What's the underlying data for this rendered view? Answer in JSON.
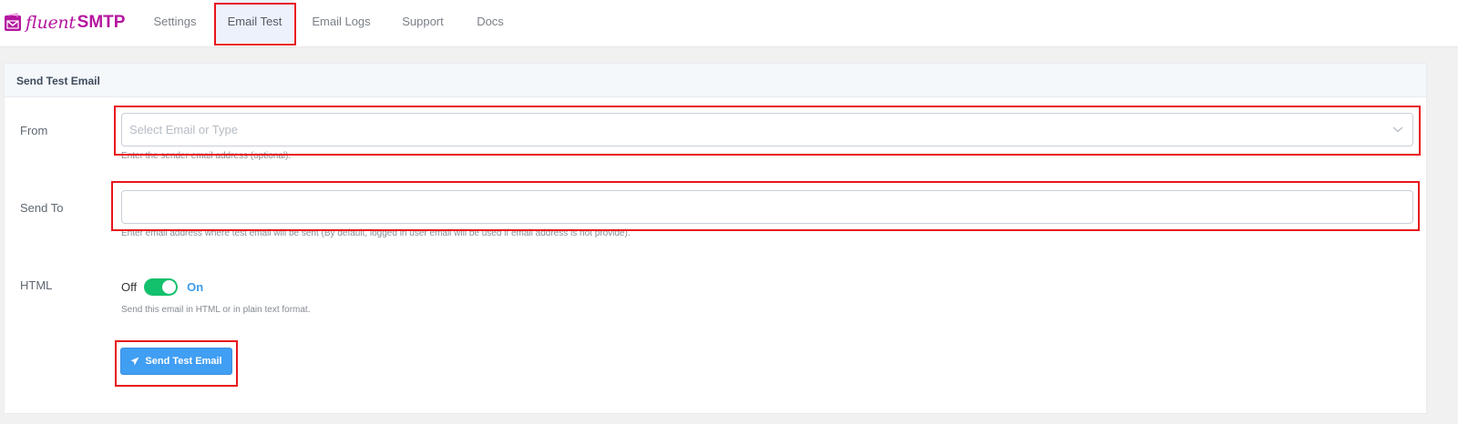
{
  "brand": {
    "name_prefix": "fluent",
    "name_suffix": "SMTP",
    "color": "#b5159f",
    "icon": "envelope-logo-icon"
  },
  "nav": {
    "tabs": [
      {
        "label": "Settings",
        "active": false
      },
      {
        "label": "Email Test",
        "active": true
      },
      {
        "label": "Email Logs",
        "active": false
      },
      {
        "label": "Support",
        "active": false
      },
      {
        "label": "Docs",
        "active": false
      }
    ]
  },
  "panel": {
    "title": "Send Test Email"
  },
  "form": {
    "from": {
      "label": "From",
      "placeholder": "Select Email or Type",
      "value": "",
      "help": "Enter the sender email address (optional)."
    },
    "send_to": {
      "label": "Send To",
      "placeholder": "",
      "value": "",
      "help": "Enter email address where test email will be sent (By default, logged in user email will be used if email address is not provide)."
    },
    "html": {
      "label": "HTML",
      "off_label": "Off",
      "on_label": "On",
      "enabled": true,
      "help": "Send this email in HTML or in plain text format."
    },
    "submit": {
      "label": "Send Test Email",
      "icon": "paper-plane-icon"
    }
  },
  "colors": {
    "toggle_on": "#13c06b",
    "on_text": "#3b9bea",
    "button": "#409ef3",
    "highlight": "#e8151c"
  }
}
